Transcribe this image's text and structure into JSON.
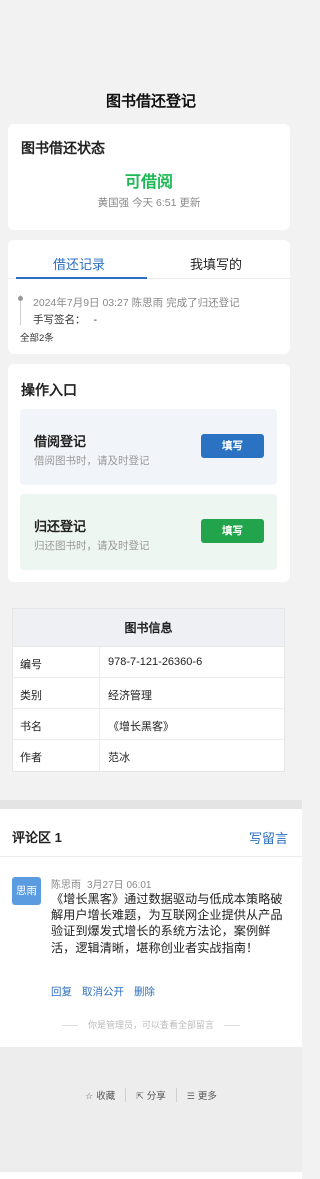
{
  "page": {
    "title": "图书借还登记"
  },
  "status": {
    "title": "图书借还状态",
    "value": "可借阅",
    "value_color": "#1db954",
    "updated_by": "黄国强",
    "updated_time": "今天 6:51",
    "updated_suffix": "更新"
  },
  "records": {
    "tabs": [
      {
        "label": "借还记录",
        "active": true
      },
      {
        "label": "我填写的",
        "active": false
      }
    ],
    "items": [
      {
        "datetime": "2024年7月9日 03:27",
        "user": "陈思雨",
        "action": "完成了归还登记",
        "signature_label": "手写签名：",
        "signature_value": "-"
      }
    ],
    "total": "全部2条"
  },
  "operations": {
    "title": "操作入口",
    "entries": [
      {
        "name": "借阅登记",
        "desc": "借阅图书时，请及时登记",
        "button": "填写",
        "button_color": "#2b72c2"
      },
      {
        "name": "归还登记",
        "desc": "归还图书时，请及时登记",
        "button": "填写",
        "button_color": "#22a44c"
      }
    ]
  },
  "book_info": {
    "title": "图书信息",
    "rows": [
      {
        "key": "编号",
        "value": "978-7-121-26360-6"
      },
      {
        "key": "类别",
        "value": "经济管理"
      },
      {
        "key": "书名",
        "value": "《增长黑客》"
      },
      {
        "key": "作者",
        "value": "范冰"
      }
    ]
  },
  "comments": {
    "header": "评论区 1",
    "write_label": "写留言",
    "items": [
      {
        "avatar_text": "思雨",
        "author": "陈思雨",
        "time": "3月27日 06:01",
        "body": "《增长黑客》通过数据驱动与低成本策略破解用户增长难题，为互联网企业提供从产品验证到爆发式增长的系统方法论，案例鲜活，逻辑清晰，堪称创业者实战指南！",
        "actions": [
          "回复",
          "取消公开",
          "删除"
        ]
      }
    ],
    "admin_note": "你是管理员，可以查看全部留言"
  },
  "footer": {
    "actions": [
      {
        "icon": "star-icon",
        "glyph": "☆",
        "label": "收藏"
      },
      {
        "icon": "share-icon",
        "glyph": "⇱",
        "label": "分享"
      },
      {
        "icon": "more-icon",
        "glyph": "☰",
        "label": "更多"
      }
    ]
  },
  "colors": {
    "accent": "#2c6fc0",
    "success": "#22a44c"
  }
}
